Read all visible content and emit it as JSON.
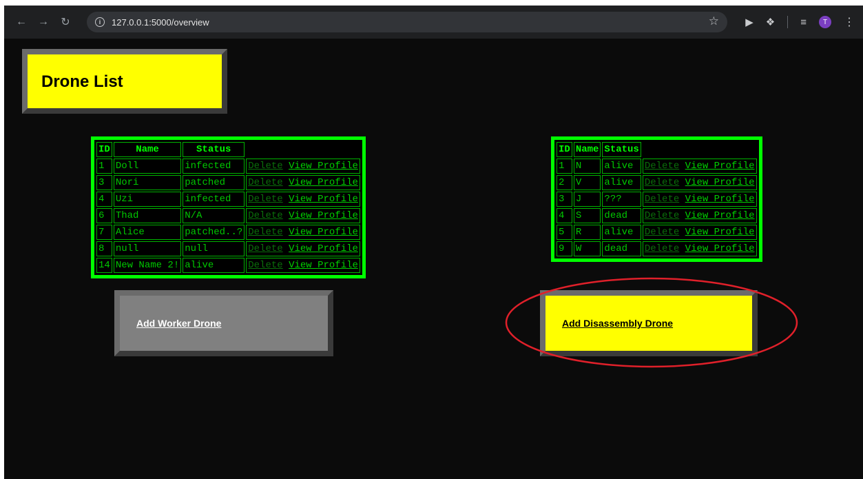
{
  "browser": {
    "url": "127.0.0.1:5000/overview",
    "profile_initial": "T"
  },
  "page": {
    "title": "Drone List",
    "worker_table": {
      "headers": [
        "ID",
        "Name",
        "Status",
        ""
      ],
      "rows": [
        {
          "id": "1",
          "name": "Doll",
          "status": "infected"
        },
        {
          "id": "3",
          "name": "Nori",
          "status": "patched"
        },
        {
          "id": "4",
          "name": "Uzi",
          "status": "infected"
        },
        {
          "id": "6",
          "name": "Thad",
          "status": "N/A"
        },
        {
          "id": "7",
          "name": "Alice",
          "status": "patched..?"
        },
        {
          "id": "8",
          "name": "null",
          "status": "null"
        },
        {
          "id": "14",
          "name": "New Name 2!",
          "status": "alive"
        }
      ]
    },
    "disassembly_table": {
      "headers": [
        "ID",
        "Name",
        "Status",
        ""
      ],
      "rows": [
        {
          "id": "1",
          "name": "N",
          "status": "alive"
        },
        {
          "id": "2",
          "name": "V",
          "status": "alive"
        },
        {
          "id": "3",
          "name": "J",
          "status": "???"
        },
        {
          "id": "4",
          "name": "S",
          "status": "dead"
        },
        {
          "id": "5",
          "name": "R",
          "status": "alive"
        },
        {
          "id": "9",
          "name": "W",
          "status": "dead"
        }
      ]
    },
    "delete_label": "Delete",
    "view_profile_label": "View Profile",
    "add_worker_label": "Add Worker Drone",
    "add_disassembly_label": "Add Disassembly Drone"
  },
  "colors": {
    "page_bg": "#0b0b0b",
    "accent_yellow": "#ffff00",
    "table_border": "#00ff00",
    "annotation": "#e0202a"
  }
}
